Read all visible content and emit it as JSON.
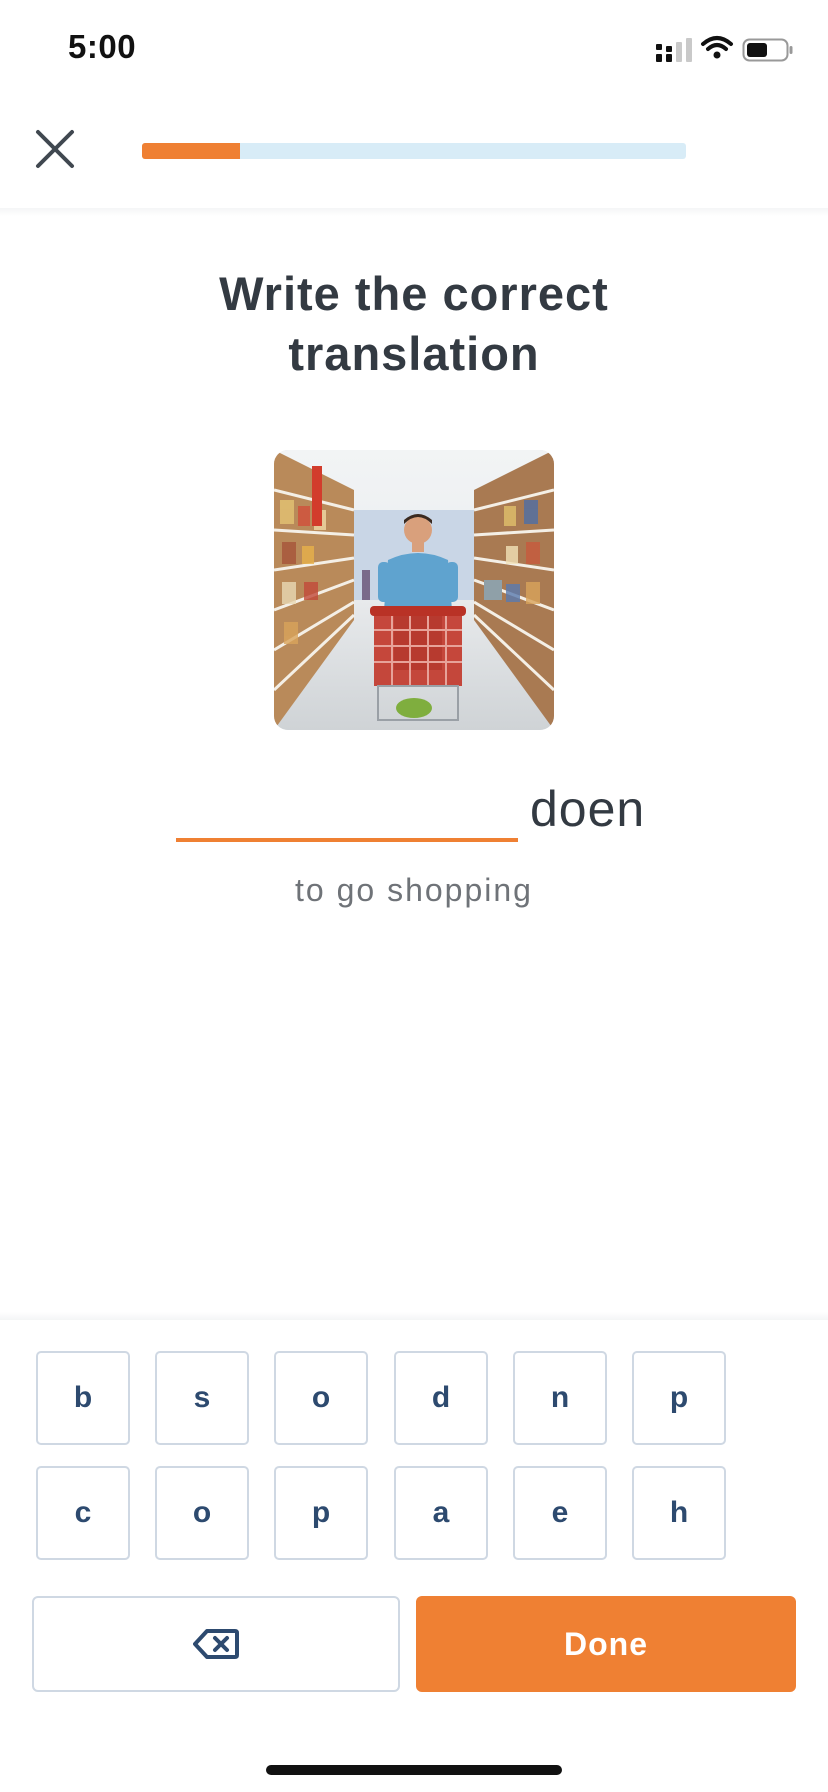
{
  "status_bar": {
    "time": "5:00",
    "icons": [
      "signal-icon",
      "wifi-icon",
      "battery-icon"
    ]
  },
  "header": {
    "close_icon": "close-icon",
    "progress_fraction": 0.18
  },
  "exercise": {
    "title_line1": "Write the correct",
    "title_line2": "translation",
    "image_icon": "supermarket-shopper-image",
    "answer_value": "",
    "suffix": "doen",
    "translation": "to go shopping"
  },
  "keyboard": {
    "row1": [
      "b",
      "s",
      "o",
      "d",
      "n",
      "p"
    ],
    "row2": [
      "c",
      "o",
      "p",
      "a",
      "e",
      "h"
    ],
    "backspace_icon": "backspace-icon",
    "done_label": "Done"
  },
  "colors": {
    "accent": "#ef8033",
    "progress_track": "#d8ecf7",
    "key_text": "#2d4a6f",
    "title_text": "#333a42"
  }
}
